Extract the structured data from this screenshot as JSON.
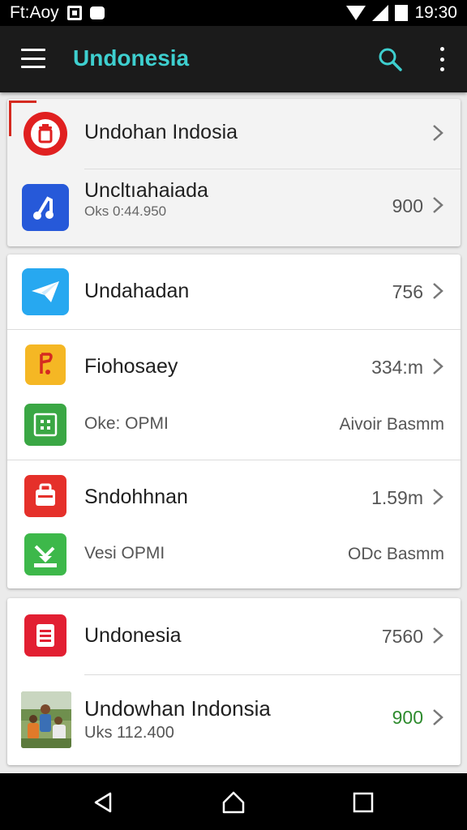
{
  "status_bar": {
    "left_text": "Ft:Aoy",
    "time": "19:30"
  },
  "app_bar": {
    "title": "Undonesia",
    "title_color": "#3ecfcf",
    "icons": [
      "menu-icon",
      "search-icon",
      "more-vert-icon"
    ]
  },
  "cards": [
    {
      "rows": [
        {
          "title": "Undohan Indosia",
          "icon": "trash-icon",
          "icon_color": "#e02020"
        },
        {
          "title": "Uncltıahaiada",
          "subtitle": "Oks 0:44.950",
          "value": "900",
          "icon": "music-note-icon",
          "icon_color": "#2659d9"
        }
      ]
    },
    {
      "rows": [
        {
          "title": "Undahadan",
          "value": "756",
          "icon": "paper-plane-icon",
          "icon_color": "#27a8f0"
        },
        {
          "title": "Fiohosaey",
          "value": "334:m",
          "icon": "music-icon",
          "icon_color": "#f5b724",
          "sub_label": "Oke: OPMI",
          "sub_value": "Aivoir Basmm",
          "sub_icon": "grid-icon",
          "sub_icon_color": "#3aa744"
        },
        {
          "title": "Sndohhnan",
          "value": "1.59m",
          "icon": "bag-icon",
          "icon_color": "#e5302a",
          "sub_label": "Vesi OPMI",
          "sub_value": "ODc Basmm",
          "sub_icon": "download-icon",
          "sub_icon_color": "#3db84a"
        }
      ]
    },
    {
      "rows": [
        {
          "title": "Undonesia",
          "value": "7560",
          "icon": "document-icon",
          "icon_color": "#e21f32"
        },
        {
          "title": "Undowhan Indonsia",
          "subtitle": "Uks 112.400",
          "value": "900",
          "value_color": "#2e8b2e",
          "icon": "photo-thumbnail"
        }
      ]
    }
  ],
  "nav_bar": {
    "buttons": [
      "back-icon",
      "home-icon",
      "recents-icon"
    ]
  }
}
